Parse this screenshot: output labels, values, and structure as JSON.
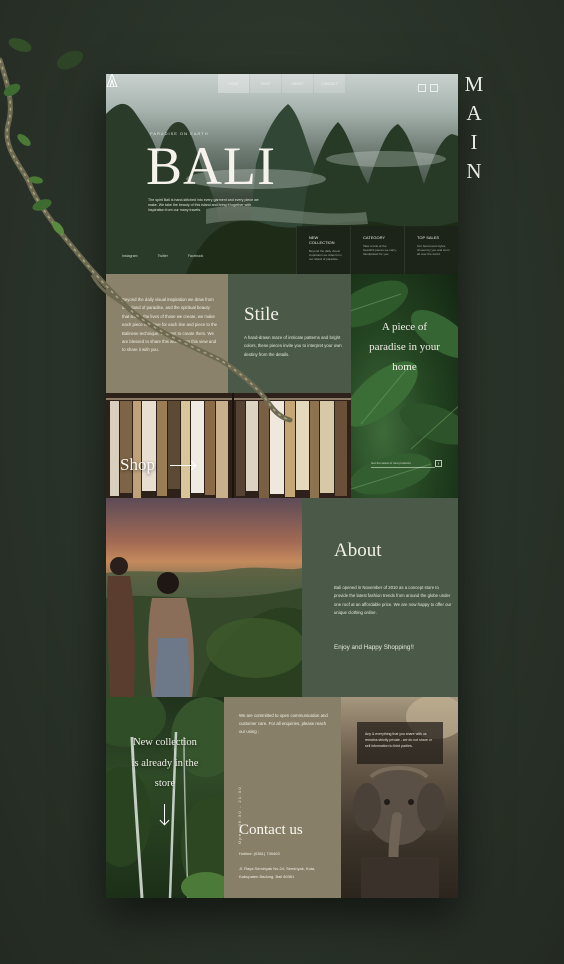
{
  "side_title": [
    "M",
    "A",
    "I",
    "N"
  ],
  "hero": {
    "nav": [
      "HOME",
      "SHOP",
      "ABOUT",
      "CONTACT"
    ],
    "kicker": "PARADISE ON EARTH",
    "title": "BALI",
    "intro": "The spirit Bali is hand-stitched into every garment and every piece we make. We take the beauty of this island and bring it together with inspiration from our many travels.",
    "bottom_nav": [
      "Instagram",
      "Twitter",
      "Facebook"
    ],
    "cards": [
      {
        "title": "NEW COLLECTION",
        "text": "Beyond the daily visual inspiration we draw from our island of paradise."
      },
      {
        "title": "CATEGORY",
        "text": "Take a look at the beautiful pieces we carry, handpicked for you."
      },
      {
        "title": "TOP SALES",
        "text": "Our best-loved styles, chosen by you and worn all over the world."
      }
    ]
  },
  "beyond": {
    "text": "Beyond the daily visual inspiration we draw from our island of paradise, and the spiritual beauty that shape the lives of those we create, we make each piece with love for each line and piece to the Balinese technique, we want to create them. We are blessed to share this world from this view and to share it with you."
  },
  "stile": {
    "title": "Stile",
    "text": "A hand-drawn maze of intricate patterns and bright colors, these pieces invite you to interpret your own destiny from the details."
  },
  "paradise": {
    "title_lines": [
      "A piece of",
      "paradise in your",
      "home"
    ],
    "input_placeholder": "Get the latest of new products",
    "button": "›"
  },
  "shop": {
    "label": "Shop"
  },
  "about": {
    "title": "About",
    "text": "Bali opened in November of 2010 as a concept store to provide the latest fashion trends from around the globe under one roof at an affordable price. We are now happy to offer our unique clothing online.",
    "enjoy": "Enjoy and Happy Shopping!!"
  },
  "new_collection": {
    "title_lines": [
      "New collection",
      "is already in the",
      "store"
    ]
  },
  "contact": {
    "commitment": "We are committed to open communication and customer care. For all enquiries, please reach our using :",
    "hours": "Open 09:30 - 21:00",
    "title": "Contact us",
    "hotline": "Hotline: (0361) 739403",
    "address": "Jl. Raya Seminyak No.24, Seminyak, Kuta, Kabupaten Badung, Bali 80361"
  },
  "ganesh": {
    "note": "Any & everything that you share with us remains strictly private - we do not share or sell information to third parties."
  }
}
